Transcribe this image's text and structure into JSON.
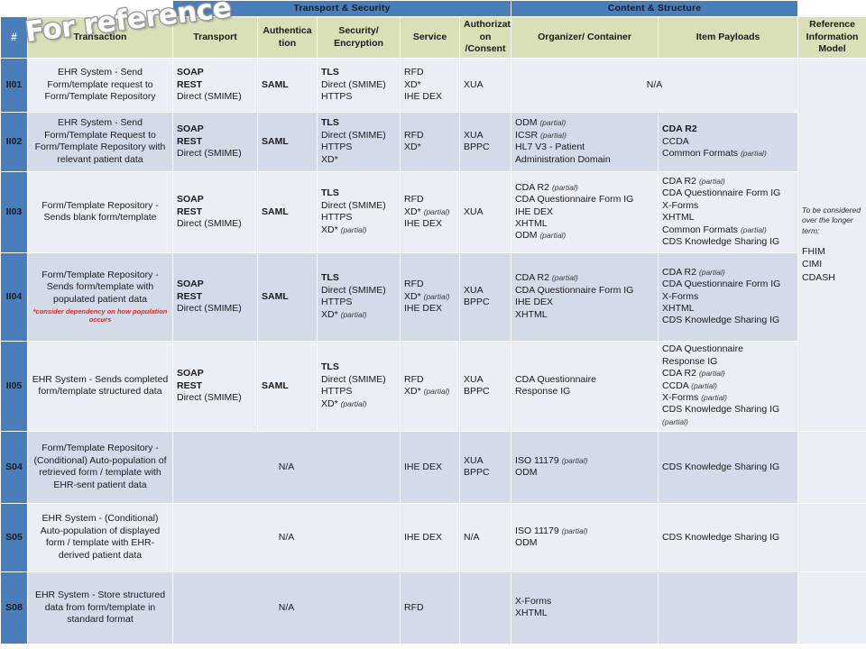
{
  "groups": {
    "transport_security": "Transport & Security",
    "content_structure": "Content & Structure"
  },
  "watermark": {
    "text": "For reference"
  },
  "columns": {
    "hash": "#",
    "transaction": "Transaction",
    "transport": "Transport",
    "authentication": "Authentica tion",
    "security_encryption": "Security/ Encryption",
    "service": "Service",
    "authorization_consent": "Authorizati on /Consent",
    "organizer_container": "Organizer/ Container",
    "item_payloads": "Item Payloads",
    "reference_information_model": "Reference Information Model"
  },
  "rim": {
    "note": "To be considered over the longer term:",
    "items": [
      "FHIM",
      "CIMI",
      "CDASH"
    ]
  },
  "na": "N/A",
  "rows": [
    {
      "id": "II01",
      "transaction": "EHR System  - Send Form/template  request to Form/Template  Repository",
      "transport": [
        {
          "t": "SOAP",
          "b": true
        },
        {
          "t": "REST",
          "b": true
        },
        {
          "t": "Direct (SMIME)"
        }
      ],
      "authentication": [
        {
          "t": "SAML",
          "b": true
        }
      ],
      "security_encryption": [
        {
          "t": "TLS",
          "b": true
        },
        {
          "t": "Direct (SMIME)"
        },
        {
          "t": "HTTPS"
        }
      ],
      "service": [
        {
          "t": "RFD"
        },
        {
          "t": "XD*"
        },
        {
          "t": "IHE DEX"
        }
      ],
      "authorization_consent": [
        {
          "t": "XUA"
        }
      ],
      "merged_content": "N/A"
    },
    {
      "id": "II02",
      "transaction": "EHR System - Send Form/Template  Request to Form/Template  Repository with relevant patient data",
      "transport": [
        {
          "t": "SOAP",
          "b": true
        },
        {
          "t": "REST",
          "b": true
        },
        {
          "t": "Direct (SMIME)"
        }
      ],
      "authentication": [
        {
          "t": "SAML",
          "b": true
        }
      ],
      "security_encryption": [
        {
          "t": "TLS",
          "b": true
        },
        {
          "t": "Direct (SMIME)"
        },
        {
          "t": "HTTPS"
        },
        {
          "t": "XD*"
        }
      ],
      "service": [
        {
          "t": "RFD"
        },
        {
          "t": "XD*"
        }
      ],
      "authorization_consent": [
        {
          "t": "XUA"
        },
        {
          "t": "BPPC"
        }
      ],
      "organizer_container": [
        {
          "t": "ODM",
          "p": "(partial)"
        },
        {
          "t": "ICSR",
          "p": "(partial)"
        },
        {
          "t": "HL7 V3 - Patient"
        },
        {
          "t": "Administration  Domain"
        }
      ],
      "item_payloads": [
        {
          "t": "CDA R2",
          "b": true
        },
        {
          "t": "CCDA"
        },
        {
          "t": "Common Formats",
          "p": "(partial)"
        }
      ]
    },
    {
      "id": "II03",
      "transaction": "Form/Template Repository  - Sends blank form/template",
      "transport": [
        {
          "t": "SOAP",
          "b": true
        },
        {
          "t": "REST",
          "b": true
        },
        {
          "t": "Direct (SMIME)"
        }
      ],
      "authentication": [
        {
          "t": "SAML",
          "b": true
        }
      ],
      "security_encryption": [
        {
          "t": "TLS",
          "b": true
        },
        {
          "t": "Direct (SMIME)"
        },
        {
          "t": "HTTPS"
        },
        {
          "t": "XD*",
          "p": "(partial)"
        }
      ],
      "service": [
        {
          "t": "RFD"
        },
        {
          "t": "XD*",
          "p": "(partial)"
        },
        {
          "t": "IHE DEX"
        }
      ],
      "authorization_consent": [
        {
          "t": "XUA"
        }
      ],
      "organizer_container": [
        {
          "t": "CDA R2",
          "p": "(partial)"
        },
        {
          "t": "CDA Questionnaire Form IG"
        },
        {
          "t": "IHE DEX"
        },
        {
          "t": "XHTML"
        },
        {
          "t": "ODM",
          "p": "(partial)"
        }
      ],
      "item_payloads": [
        {
          "t": "CDA R2",
          "p": "(partial)"
        },
        {
          "t": "CDA Questionnaire Form IG"
        },
        {
          "t": "X-Forms"
        },
        {
          "t": "XHTML"
        },
        {
          "t": "Common Formats",
          "p": "(partial)"
        },
        {
          "t": "CDS Knowledge  Sharing IG"
        }
      ]
    },
    {
      "id": "II04",
      "transaction": "Form/Template Repository  - Sends form/template  with populated patient data",
      "transaction_note": "*consider dependency on how population occurs",
      "transport": [
        {
          "t": "SOAP",
          "b": true
        },
        {
          "t": "REST",
          "b": true
        },
        {
          "t": "Direct (SMIME)"
        }
      ],
      "authentication": [
        {
          "t": "SAML",
          "b": true
        }
      ],
      "security_encryption": [
        {
          "t": "TLS",
          "b": true
        },
        {
          "t": "Direct (SMIME)"
        },
        {
          "t": "HTTPS"
        },
        {
          "t": "XD*",
          "p": "(partial)"
        }
      ],
      "service": [
        {
          "t": "RFD"
        },
        {
          "t": "XD*",
          "p": "(partial)"
        },
        {
          "t": "IHE DEX"
        }
      ],
      "authorization_consent": [
        {
          "t": "XUA"
        },
        {
          "t": "BPPC"
        }
      ],
      "organizer_container": [
        {
          "t": "CDA R2",
          "p": "(partial)"
        },
        {
          "t": "CDA Questionnaire Form IG"
        },
        {
          "t": "IHE DEX"
        },
        {
          "t": "XHTML"
        }
      ],
      "item_payloads": [
        {
          "t": "CDA R2",
          "p": "(partial)"
        },
        {
          "t": "CDA Questionnaire Form IG"
        },
        {
          "t": "X-Forms"
        },
        {
          "t": "XHTML"
        },
        {
          "t": "CDS Knowledge Sharing IG"
        }
      ]
    },
    {
      "id": "II05",
      "transaction": "EHR System  - Sends completed form/template  structured data",
      "transport": [
        {
          "t": "SOAP",
          "b": true
        },
        {
          "t": "REST",
          "b": true
        },
        {
          "t": "Direct (SMIME)"
        }
      ],
      "authentication": [
        {
          "t": "SAML",
          "b": true
        }
      ],
      "security_encryption": [
        {
          "t": "TLS",
          "b": true
        },
        {
          "t": "Direct (SMIME)"
        },
        {
          "t": "HTTPS"
        },
        {
          "t": "XD*",
          "p": "(partial)"
        }
      ],
      "service": [
        {
          "t": "RFD"
        },
        {
          "t": "XD*",
          "p": "(partial)"
        }
      ],
      "authorization_consent": [
        {
          "t": "XUA"
        },
        {
          "t": "BPPC"
        }
      ],
      "organizer_container": [
        {
          "t": "CDA Questionnaire"
        },
        {
          "t": "Response IG"
        }
      ],
      "item_payloads": [
        {
          "t": "CDA Questionnaire"
        },
        {
          "t": "Response IG"
        },
        {
          "t": "CDA R2",
          "p": "(partial)"
        },
        {
          "t": "CCDA",
          "p": "(partial)"
        },
        {
          "t": "X-Forms",
          "p": "(partial)"
        },
        {
          "t": "CDS Knowledge Sharing IG"
        },
        {
          "t": "",
          "p": "(partial)"
        }
      ]
    },
    {
      "id": "S04",
      "transaction": "Form/Template Repository - (Conditional) Auto-population of retrieved form / template  with EHR-sent patient data",
      "merged_ts": "N/A",
      "service": [
        {
          "t": "IHE DEX"
        }
      ],
      "authorization_consent": [
        {
          "t": "XUA"
        },
        {
          "t": "BPPC"
        }
      ],
      "organizer_container": [
        {
          "t": "ISO 11179",
          "p": "(partial)"
        },
        {
          "t": "ODM"
        }
      ],
      "item_payloads": [
        {
          "t": "CDS Knowledge Sharing IG"
        }
      ],
      "rim": ""
    },
    {
      "id": "S05",
      "transaction": "EHR System - (Conditional) Auto-population of displayed form / template with EHR-derived patient data",
      "merged_ts": "N/A",
      "service": [
        {
          "t": "IHE DEX"
        }
      ],
      "authorization_consent": [
        {
          "t": "N/A"
        }
      ],
      "organizer_container": [
        {
          "t": "ISO 11179",
          "p": "(partial)"
        },
        {
          "t": "ODM"
        }
      ],
      "item_payloads": [
        {
          "t": "CDS Knowledge Sharing IG"
        }
      ],
      "rim": ""
    },
    {
      "id": "S08",
      "transaction": "EHR System - Store structured data from form/template  in standard format",
      "merged_ts": "N/A",
      "service": [
        {
          "t": "RFD"
        }
      ],
      "authorization_consent": [],
      "organizer_container": [
        {
          "t": "X-Forms"
        },
        {
          "t": "XHTML"
        }
      ],
      "item_payloads": [],
      "rim": ""
    }
  ]
}
